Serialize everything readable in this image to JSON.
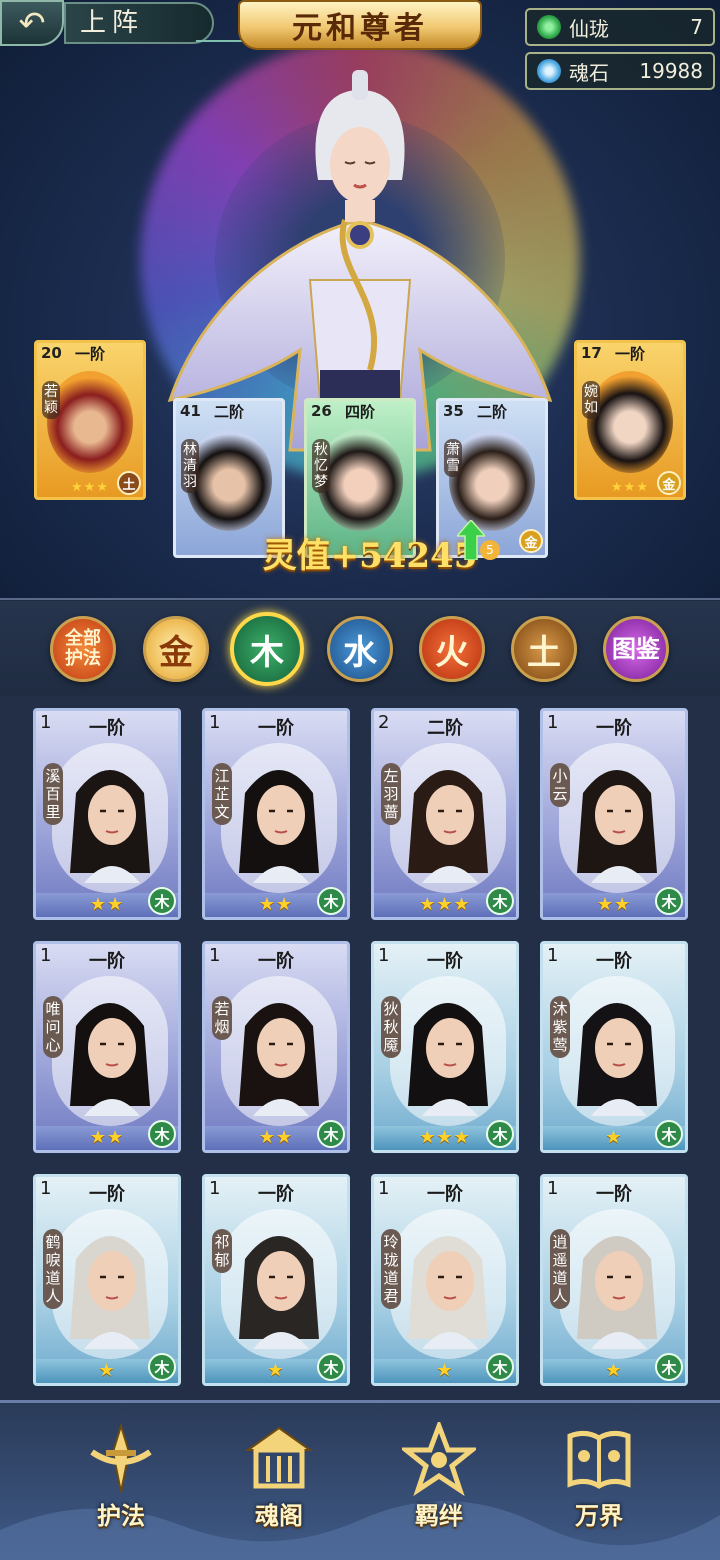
{
  "header": {
    "back_icon": "back-arrow-icon",
    "screen_title": "上阵",
    "hero_title": "元和尊者"
  },
  "currencies": [
    {
      "name": "仙珑",
      "value": "7",
      "icon": "jade-icon",
      "color": "#2fa84a"
    },
    {
      "name": "魂石",
      "value": "19988",
      "icon": "soul-stone-icon",
      "color": "#4aa8e0"
    }
  ],
  "lineup": [
    {
      "level": "20",
      "rank": "一阶",
      "name": "若颖",
      "stars": "★★★",
      "element": "土",
      "quality": "gold"
    },
    {
      "level": "41",
      "rank": "二阶",
      "name": "林清羽",
      "stars": "",
      "element": "",
      "quality": "blue"
    },
    {
      "level": "26",
      "rank": "四阶",
      "name": "秋忆梦",
      "stars": "",
      "element": "",
      "quality": "green"
    },
    {
      "level": "35",
      "rank": "二阶",
      "name": "萧雪",
      "stars": "",
      "element": "金",
      "quality": "blue"
    },
    {
      "level": "17",
      "rank": "一阶",
      "name": "婉如",
      "stars": "★★★",
      "element": "金",
      "quality": "gold"
    }
  ],
  "power": {
    "text": "灵值+54245",
    "arrow_icon": "up-arrow-icon",
    "arrow_badge": "5"
  },
  "filters": [
    {
      "label": "全部护法",
      "color": "#e0562a",
      "active": false
    },
    {
      "label": "金",
      "color": "#d98a1c",
      "active": false
    },
    {
      "label": "木",
      "color": "#1f8a4a",
      "active": true
    },
    {
      "label": "水",
      "color": "#2a6fb0",
      "active": false
    },
    {
      "label": "火",
      "color": "#d6451e",
      "active": false
    },
    {
      "label": "土",
      "color": "#a0601e",
      "active": false
    },
    {
      "label": "图鉴",
      "color": "#a640b8",
      "active": false
    }
  ],
  "roster": [
    {
      "level": "1",
      "rank": "一阶",
      "name": "溪百里",
      "stars": "★★",
      "element": "木",
      "frame": "purple",
      "hair": "#1a1412"
    },
    {
      "level": "1",
      "rank": "一阶",
      "name": "江芷文",
      "stars": "★★",
      "element": "木",
      "frame": "purple",
      "hair": "#141010"
    },
    {
      "level": "2",
      "rank": "二阶",
      "name": "左羽蔷",
      "stars": "★★★",
      "element": "木",
      "frame": "purple",
      "hair": "#2a1c14"
    },
    {
      "level": "1",
      "rank": "一阶",
      "name": "小云",
      "stars": "★★",
      "element": "木",
      "frame": "purple",
      "hair": "#1e1612"
    },
    {
      "level": "1",
      "rank": "一阶",
      "name": "唯问心",
      "stars": "★★",
      "element": "木",
      "frame": "purple",
      "hair": "#141010"
    },
    {
      "level": "1",
      "rank": "一阶",
      "name": "若烟",
      "stars": "★★",
      "element": "木",
      "frame": "purple",
      "hair": "#1a1210"
    },
    {
      "level": "1",
      "rank": "一阶",
      "name": "狄秋魇",
      "stars": "★★★",
      "element": "木",
      "frame": "teal",
      "hair": "#121010"
    },
    {
      "level": "1",
      "rank": "一阶",
      "name": "沐紫莺",
      "stars": "★",
      "element": "木",
      "frame": "teal",
      "hair": "#141214"
    },
    {
      "level": "1",
      "rank": "一阶",
      "name": "鹤唳道人",
      "stars": "★",
      "element": "木",
      "frame": "teal",
      "hair": "#d9d6cf"
    },
    {
      "level": "1",
      "rank": "一阶",
      "name": "祁郁",
      "stars": "★",
      "element": "木",
      "frame": "teal",
      "hair": "#2a2624"
    },
    {
      "level": "1",
      "rank": "一阶",
      "name": "玲珑道君",
      "stars": "★",
      "element": "木",
      "frame": "teal",
      "hair": "#e0ddd6"
    },
    {
      "level": "1",
      "rank": "一阶",
      "name": "逍遥道人",
      "stars": "★",
      "element": "木",
      "frame": "teal",
      "hair": "#cfcac2"
    }
  ],
  "nav": [
    {
      "label": "护法",
      "icon": "sword-emblem-icon"
    },
    {
      "label": "魂阁",
      "icon": "pavilion-emblem-icon"
    },
    {
      "label": "羁绊",
      "icon": "bond-star-icon"
    },
    {
      "label": "万界",
      "icon": "book-emblem-icon"
    }
  ]
}
